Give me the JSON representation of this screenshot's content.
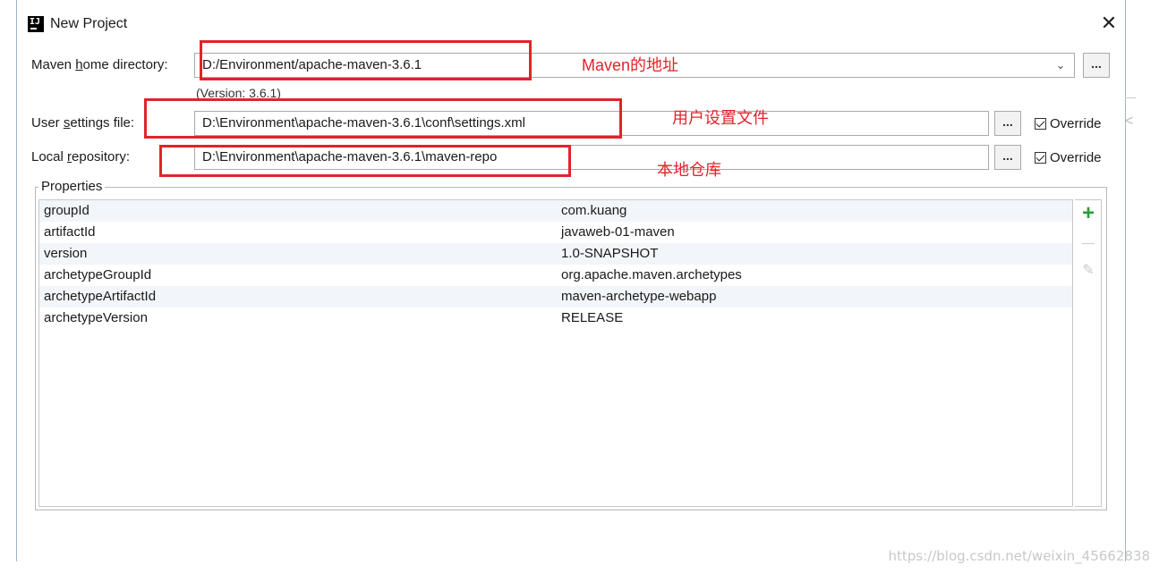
{
  "window": {
    "title": "New Project",
    "close_glyph": "✕",
    "app_icon_text": "IJ"
  },
  "form": {
    "maven_home_label_pre": "Maven ",
    "maven_home_label_u": "h",
    "maven_home_label_post": "ome directory:",
    "maven_home_value": "D:/Environment/apache-maven-3.6.1",
    "maven_version": "(Version: 3.6.1)",
    "user_settings_label_pre": "User ",
    "user_settings_label_u": "s",
    "user_settings_label_post": "ettings file:",
    "user_settings_value": "D:\\Environment\\apache-maven-3.6.1\\conf\\settings.xml",
    "local_repo_label_pre": "Local ",
    "local_repo_label_u": "r",
    "local_repo_label_post": "epository:",
    "local_repo_value": "D:\\Environment\\apache-maven-3.6.1\\maven-repo",
    "browse_label": "...",
    "override_label": "Override"
  },
  "properties": {
    "title": "Properties",
    "rows": [
      {
        "key": "groupId",
        "value": "com.kuang"
      },
      {
        "key": "artifactId",
        "value": "javaweb-01-maven"
      },
      {
        "key": "version",
        "value": "1.0-SNAPSHOT"
      },
      {
        "key": "archetypeGroupId",
        "value": "org.apache.maven.archetypes"
      },
      {
        "key": "archetypeArtifactId",
        "value": "maven-archetype-webapp"
      },
      {
        "key": "archetypeVersion",
        "value": "RELEASE"
      }
    ],
    "tools": {
      "add": "+",
      "remove": "—",
      "edit": "✎"
    }
  },
  "annotations": {
    "maven_note": "Maven的地址",
    "settings_note": "用户设置文件",
    "repo_note": "本地仓库"
  },
  "watermark": "https://blog.csdn.net/weixin_45662838",
  "colors": {
    "annotation": "#e0242b",
    "add_icon": "#2e9c3a"
  }
}
